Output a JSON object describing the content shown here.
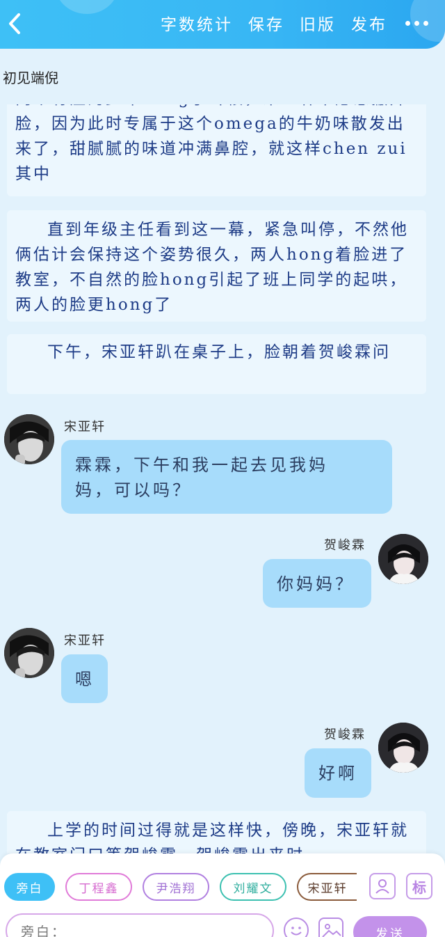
{
  "header": {
    "actions": [
      "字数统计",
      "保存",
      "旧版",
      "发布"
    ]
  },
  "story": {
    "title": "初见端倪"
  },
  "narrations": [
    "两个有症的少年hong了耳根，宋亚轩不愿意撇开脸，因为此时专属于这个omega的牛奶味散发出来了，甜腻腻的味道冲满鼻腔，就这样chen zui其中",
    "直到年级主任看到这一幕，紧急叫停，不然他俩估计会保持这个姿势很久，两人hong着脸进了教室，不自然的脸hong引起了班上同学的起哄，两人的脸更hong了",
    "下午，宋亚轩趴在桌子上，脸朝着贺峻霖问",
    "上学的时间过得就是这样快，傍晚，宋亚轩就在教室门口等贺峻霖，贺峻霖出来时"
  ],
  "messages": [
    {
      "speaker": "宋亚轩",
      "side": "left",
      "text": "霖霖，下午和我一起去见我妈妈，可以吗？"
    },
    {
      "speaker": "贺峻霖",
      "side": "right",
      "text": "你妈妈？"
    },
    {
      "speaker": "宋亚轩",
      "side": "left",
      "text": "嗯"
    },
    {
      "speaker": "贺峻霖",
      "side": "right",
      "text": "好啊"
    }
  ],
  "roles": [
    {
      "label": "旁白",
      "color": "#3ec0f6",
      "selected": true
    },
    {
      "label": "丁程鑫",
      "color": "#e07ad8",
      "selected": false
    },
    {
      "label": "尹浩翔",
      "color": "#b07fe0",
      "selected": false
    },
    {
      "label": "刘耀文",
      "color": "#3bc0b0",
      "selected": false
    },
    {
      "label": "宋亚轩",
      "color": "#8a5a3a",
      "selected": false
    }
  ],
  "tools": {
    "tag_label": "标"
  },
  "input": {
    "placeholder": "旁白："
  },
  "send_label": "发送",
  "icons": {
    "back": "back-arrow-icon",
    "more": "more-dots-icon",
    "character": "character-icon",
    "emoji": "emoji-icon",
    "image": "image-icon"
  }
}
